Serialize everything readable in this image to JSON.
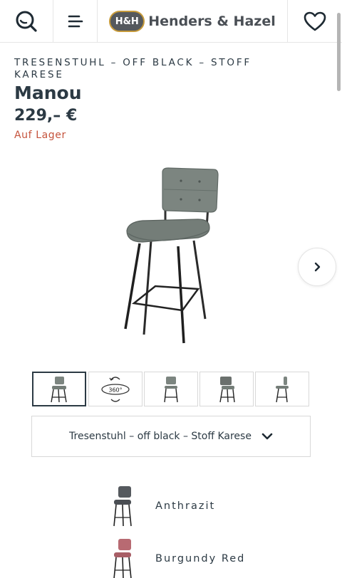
{
  "header": {
    "logo_badge": "H&H",
    "logo_text": "Henders & Hazel"
  },
  "product": {
    "subtitle": "TRESENSTUHL – OFF BLACK – STOFF KARESE",
    "name": "Manou",
    "price": "229,– €",
    "stock": "Auf Lager",
    "thumb_360_label": "360°"
  },
  "variant_select": {
    "selected": "Tresenstuhl – off black – Stoff Karese"
  },
  "colors": [
    {
      "label": "Anthrazit",
      "swatch": "#55595e"
    },
    {
      "label": "Burgundy Red",
      "swatch": "#b86a72"
    }
  ],
  "theme": {
    "accent_text": "#2c3a44",
    "stock_color": "#c5533c",
    "logo_gold": "#c69a3a",
    "chair_fabric": "#7c8580"
  },
  "icons": {
    "search": "search-icon",
    "menu": "menu-icon",
    "wishlist": "heart-icon",
    "next": "chevron-right-icon",
    "dropdown": "chevron-down-icon",
    "rotate": "rotate-360-icon"
  }
}
